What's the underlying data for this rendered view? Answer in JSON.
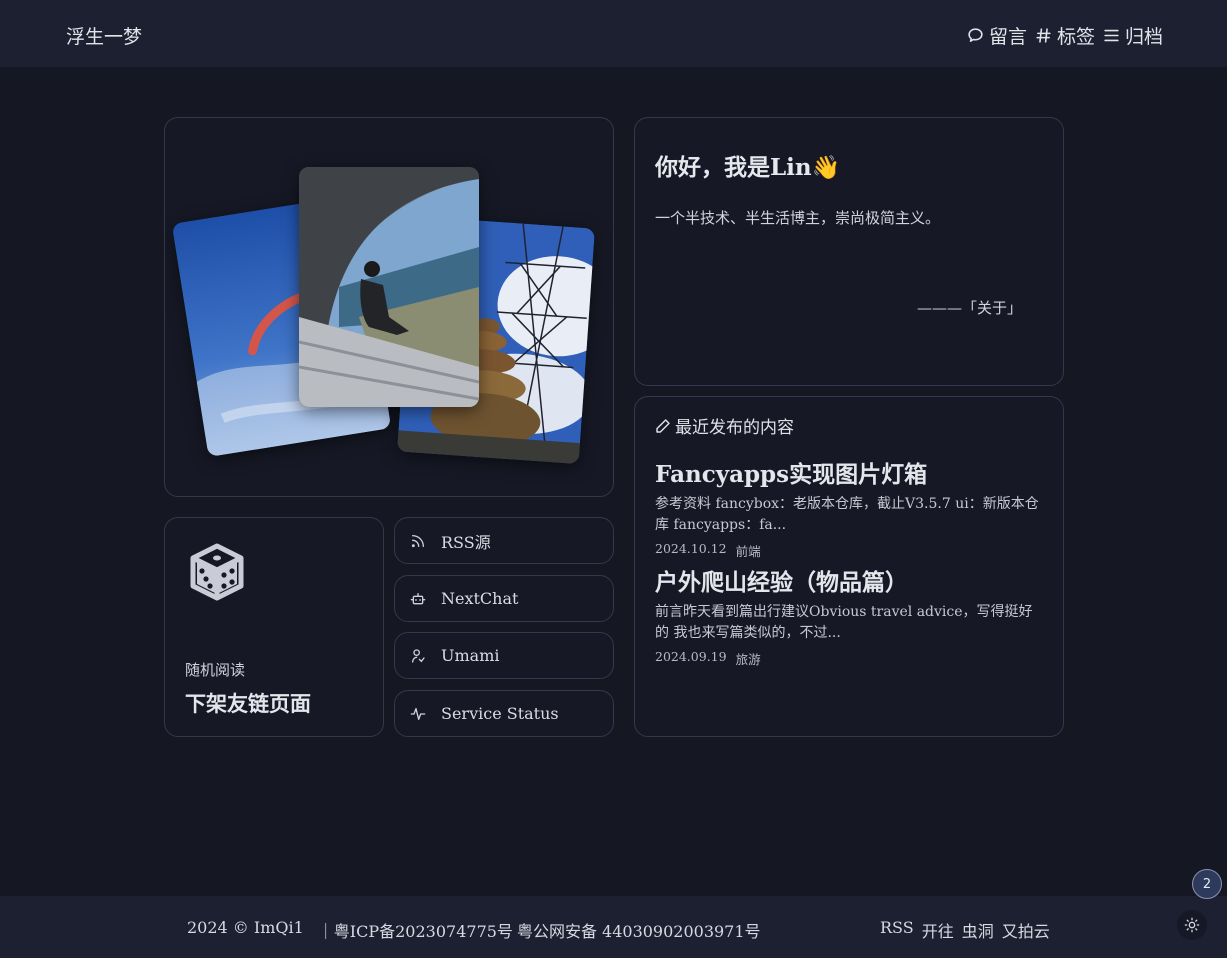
{
  "header": {
    "site_title": "浮生一梦",
    "nav": [
      {
        "label": "留言",
        "icon": "message-icon"
      },
      {
        "label": "标签",
        "icon": "hash-icon"
      },
      {
        "label": "归档",
        "icon": "list-icon"
      }
    ]
  },
  "photos": [
    {
      "subject": "paraglider"
    },
    {
      "subject": "person-sitting-window"
    },
    {
      "subject": "stacked-rocks-power-tower"
    }
  ],
  "intro": {
    "title": "你好，我是Lin👋",
    "description": "一个半技术、半生活博主，崇尚极简主义。",
    "about_link": "———「关于」"
  },
  "recent": {
    "heading": "最近发布的内容",
    "posts": [
      {
        "title": "Fancyapps实现图片灯箱",
        "excerpt": "参考资料 fancybox：老版本仓库，截止V3.5.7 ui：新版本仓库 fancyapps：fa...",
        "date": "2024.10.12",
        "category": "前端"
      },
      {
        "title": "户外爬山经验（物品篇）",
        "excerpt": "前言昨天看到篇出行建议Obvious travel advice，写得挺好的 我也来写篇类似的，不过...",
        "date": "2024.09.19",
        "category": "旅游"
      }
    ]
  },
  "random": {
    "label": "随机阅读",
    "title": "下架友链页面"
  },
  "links": [
    {
      "label": "RSS源",
      "icon": "rss-icon"
    },
    {
      "label": "NextChat",
      "icon": "robot-icon"
    },
    {
      "label": "Umami",
      "icon": "user-icon"
    },
    {
      "label": "Service Status",
      "icon": "activity-icon"
    }
  ],
  "footer": {
    "copyright": "2024 © ImQi1",
    "icp": "｜粤ICP备2023074775号",
    "police": "粤公网安备 44030902003971号",
    "links": [
      "RSS",
      "开往",
      "虫洞",
      "又拍云"
    ]
  },
  "badge_count": "2"
}
